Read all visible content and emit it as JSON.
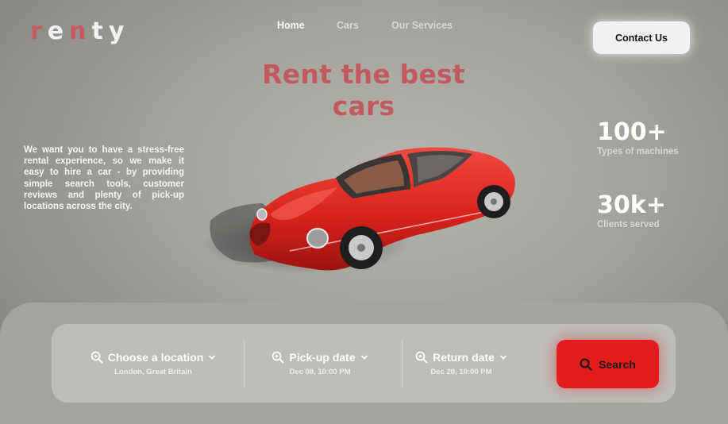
{
  "logo": {
    "letters": [
      "r",
      "e",
      "n",
      "t",
      "y"
    ]
  },
  "nav": {
    "items": [
      "Home",
      "Cars",
      "Our Services"
    ]
  },
  "header": {
    "contact_label": "Contact Us"
  },
  "hero": {
    "title_line1": "Rent the best",
    "title_line2": "cars",
    "intro": "We want you to have a stress-free rental experience, so we make it easy to hire a car - by providing simple search tools, customer reviews and plenty of pick-up locations across the city."
  },
  "stats": [
    {
      "value": "100+",
      "label": "Types of machines"
    },
    {
      "value": "30k+",
      "label": "Clients served"
    }
  ],
  "search": {
    "fields": [
      {
        "label": "Choose a location",
        "value": "London, Great Britain",
        "icon": "search-zoom-icon"
      },
      {
        "label": "Pick-up date",
        "value": "Dec 08, 10:00 PM",
        "icon": "search-zoom-icon"
      },
      {
        "label": "Return date",
        "value": "Dec 20, 10:00 PM",
        "icon": "search-zoom-icon"
      }
    ],
    "button_label": "Search"
  },
  "colors": {
    "accent": "#e31c1c",
    "title": "#c05a5d",
    "panel": "#a4a39e",
    "bar": "#bdbcb8"
  }
}
